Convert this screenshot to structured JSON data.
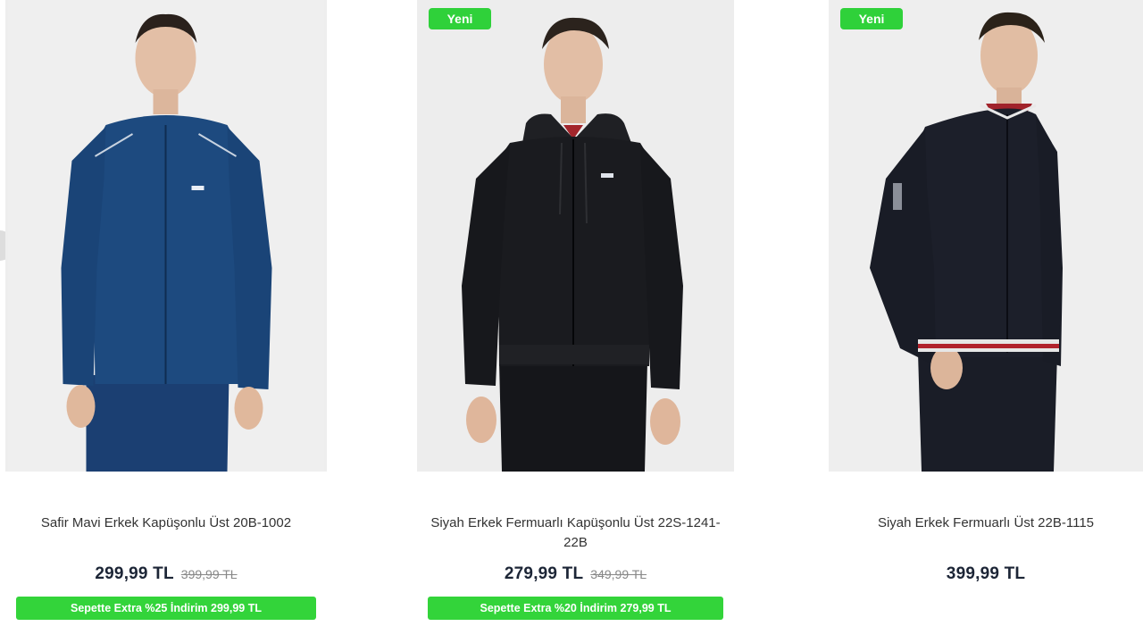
{
  "products": [
    {
      "badge": "",
      "title": "Safir Mavi Erkek Kapüşonlu Üst 20B-1002",
      "price": "299,99 TL",
      "old_price": "399,99 TL",
      "promo": "Sepette Extra %25 İndirim 299,99 TL",
      "colors": {
        "jacket": "#1d4a7f",
        "pants": "#1b3f72"
      }
    },
    {
      "badge": "Yeni",
      "title": "Siyah Erkek Fermuarlı Kapüşonlu Üst 22S-1241-22B",
      "price": "279,99 TL",
      "old_price": "349,99 TL",
      "promo": "Sepette Extra %20 İndirim 279,99 TL",
      "colors": {
        "jacket": "#1a1b1f",
        "pants": "#15161a"
      }
    },
    {
      "badge": "Yeni",
      "title": "Siyah Erkek Fermuarlı Üst 22B-1115",
      "price": "399,99 TL",
      "old_price": "",
      "promo": "",
      "colors": {
        "jacket": "#1c1f2a",
        "pants": "#1a1d27"
      }
    }
  ],
  "theme": {
    "badge_green": "#2fd13a",
    "promo_green": "#33d43a",
    "price_color": "#1c2536"
  }
}
